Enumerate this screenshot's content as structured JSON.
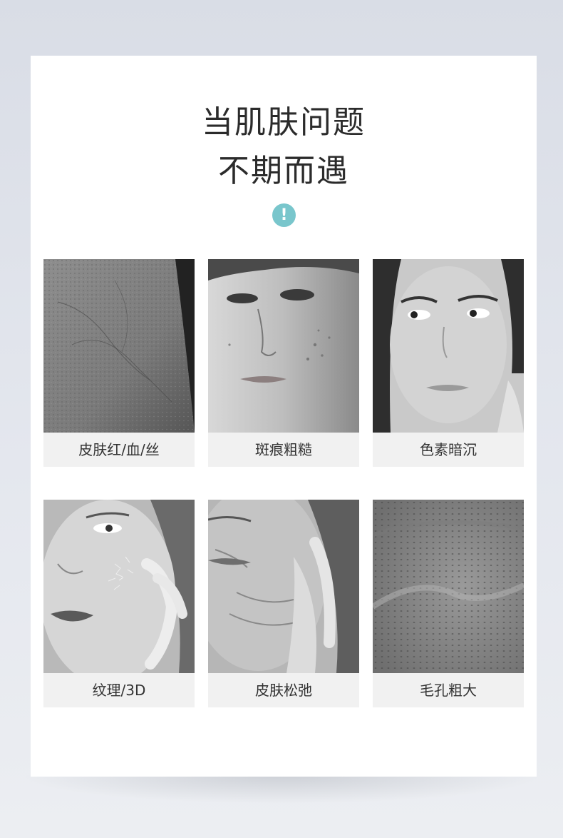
{
  "headline": {
    "line1": "当肌肤问题",
    "line2": "不期而遇"
  },
  "alert_icon": {
    "name": "exclamation-icon",
    "glyph": "!",
    "color": "#79c6cc"
  },
  "problems": [
    {
      "label": "皮肤红/血/丝"
    },
    {
      "label": "斑痕粗糙"
    },
    {
      "label": "色素暗沉"
    },
    {
      "label": "纹理/3D"
    },
    {
      "label": "皮肤松弛"
    },
    {
      "label": "毛孔粗大"
    }
  ]
}
